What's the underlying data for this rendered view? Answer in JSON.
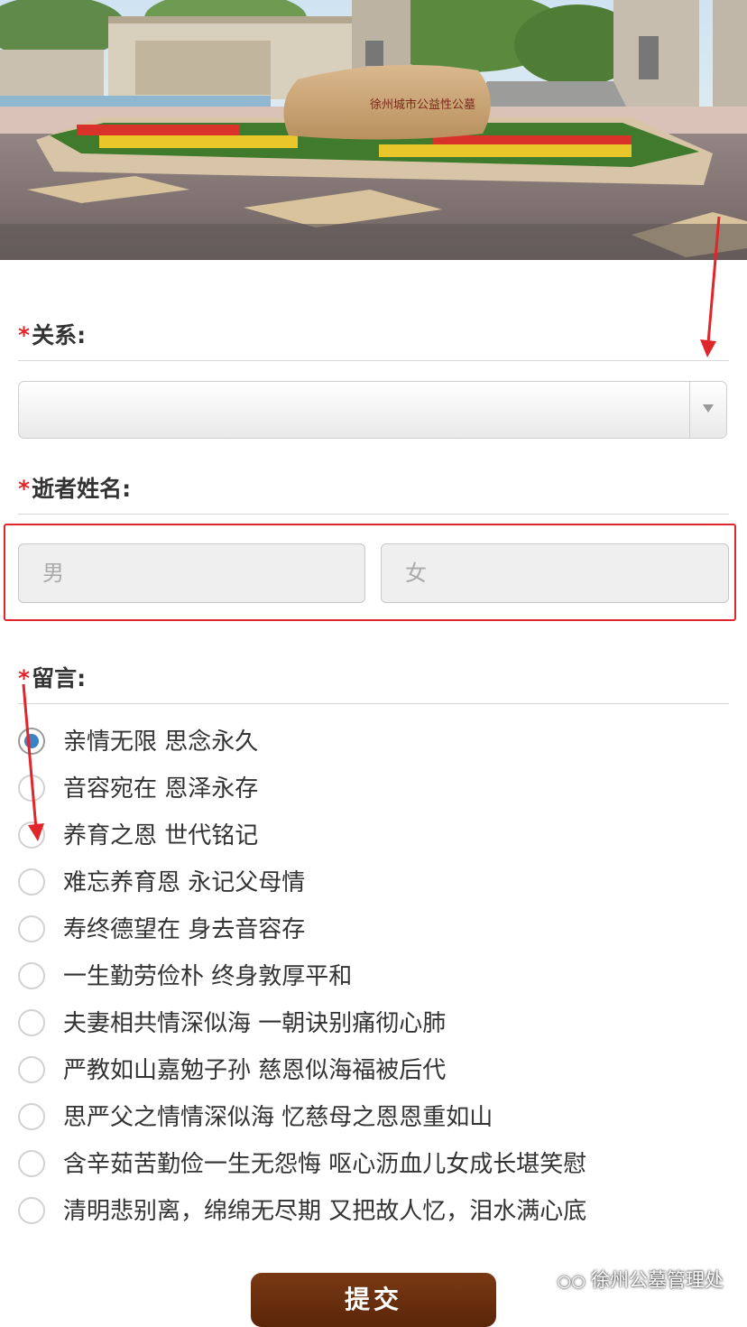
{
  "banner": {
    "stone_text": "徐州城市公益性公墓"
  },
  "form": {
    "relation": {
      "required_mark": "*",
      "label": "关系:",
      "selected_value": ""
    },
    "deceased_name": {
      "required_mark": "*",
      "label": "逝者姓名:",
      "male_placeholder": "男",
      "female_placeholder": "女"
    },
    "message": {
      "required_mark": "*",
      "label": "留言:",
      "selected_index": 0,
      "options": [
        "亲情无限 思念永久",
        "音容宛在 恩泽永存",
        "养育之恩 世代铭记",
        "难忘养育恩 永记父母情",
        "寿终德望在 身去音容存",
        "一生勤劳俭朴 终身敦厚平和",
        "夫妻相共情深似海 一朝诀别痛彻心肺",
        "严教如山嘉勉子孙 慈恩似海福被后代",
        "思严父之情情深似海 忆慈母之恩恩重如山",
        "含辛茹苦勤俭一生无怨悔 呕心沥血儿女成长堪笑慰",
        "清明悲别离，绵绵无尽期 又把故人忆，泪水满心底"
      ]
    },
    "submit_label": "提交"
  },
  "watermark": {
    "text": "徐州公墓管理处",
    "icon": "wechat-icon"
  },
  "colors": {
    "required": "#e0262b",
    "submit_bg": "#6b300e",
    "radio_selected": "#3b82c4",
    "annotation": "#e0262b"
  }
}
